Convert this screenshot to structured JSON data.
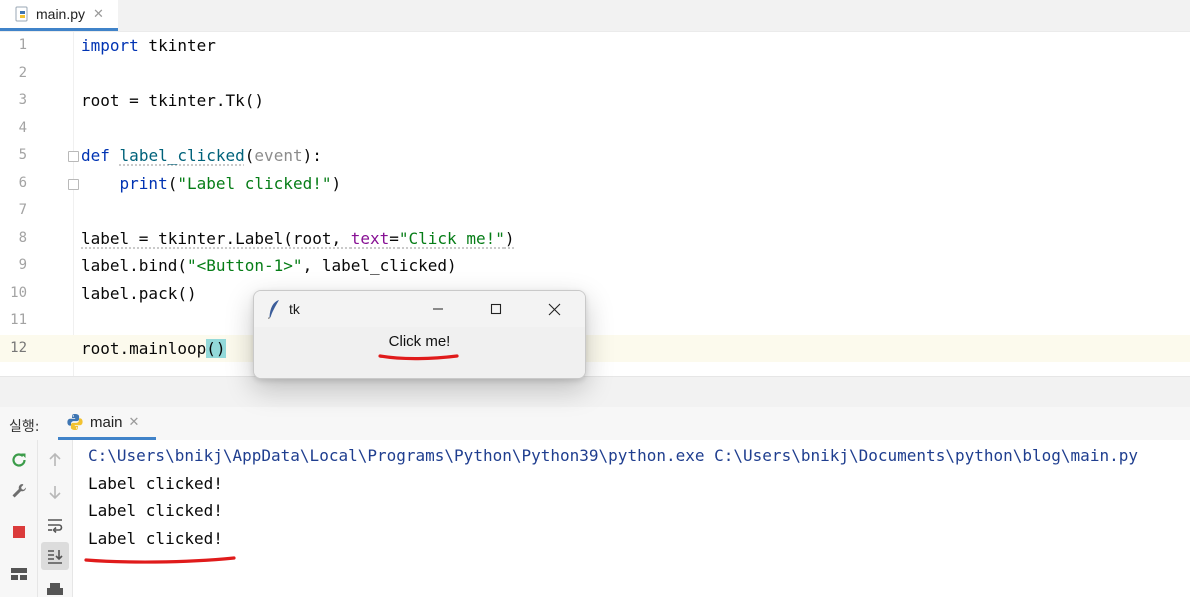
{
  "editor_tab": {
    "label": "main.py",
    "close": "✕"
  },
  "code_lines": [
    {
      "n": "1"
    },
    {
      "n": "2"
    },
    {
      "n": "3"
    },
    {
      "n": "4"
    },
    {
      "n": "5"
    },
    {
      "n": "6"
    },
    {
      "n": "7"
    },
    {
      "n": "8"
    },
    {
      "n": "9"
    },
    {
      "n": "10"
    },
    {
      "n": "11"
    },
    {
      "n": "12"
    }
  ],
  "code": {
    "l1_kw": "import",
    "l1_rest": " tkinter",
    "l3": "root = tkinter.Tk()",
    "l5_kw": "def",
    "l5_fn": "label_clicked",
    "l5_open": "(",
    "l5_param": "event",
    "l5_close": "):",
    "l6_indent": "    ",
    "l6_fn": "print",
    "l6_open": "(",
    "l6_str": "\"Label clicked!\"",
    "l6_close": ")",
    "l8_a": "label = tkinter.Label(root, ",
    "l8_kwarg": "text",
    "l8_eq": "=",
    "l8_str": "\"Click me!\"",
    "l8_close": ")",
    "l9_a": "label.bind(",
    "l9_str": "\"<Button-1>\"",
    "l9_b": ", label_clicked)",
    "l10": "label.pack()",
    "l12_a": "root.mainloop",
    "l12_paren": "()"
  },
  "run_panel": {
    "label": "실행:",
    "tab_label": "main",
    "tab_close": "✕",
    "console_lines": [
      "C:\\Users\\bnikj\\AppData\\Local\\Programs\\Python\\Python39\\python.exe C:\\Users\\bnikj\\Documents\\python\\blog\\main.py",
      "Label clicked!",
      "Label clicked!",
      "Label clicked!"
    ]
  },
  "tk_window": {
    "title": "tk",
    "label": "Click me!",
    "minimize": "minimize-icon",
    "maximize": "maximize-icon",
    "close": "close-icon"
  },
  "colors": {
    "accent": "#4083c9",
    "keyword": "#0033b3",
    "string": "#067d17",
    "function": "#00627a",
    "annotation_red": "#e01b1b",
    "stop_red": "#db3b3b",
    "rerun_green": "#3c9c4a"
  }
}
